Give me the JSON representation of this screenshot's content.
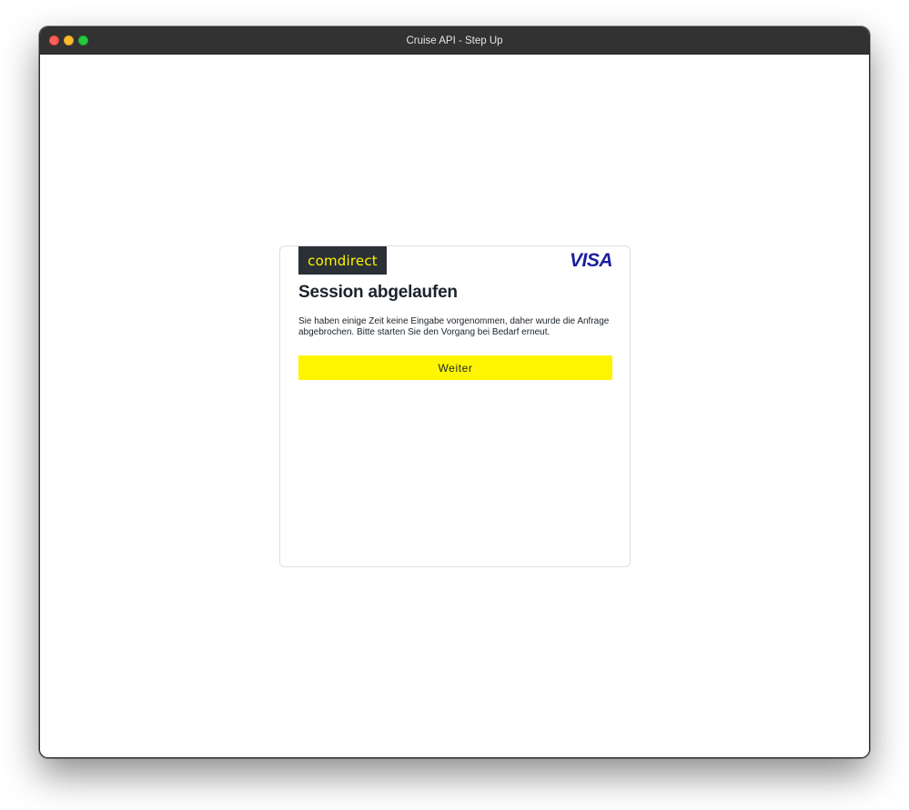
{
  "window": {
    "title": "Cruise API - Step Up"
  },
  "card": {
    "brand_left": "comdirect",
    "brand_right": "VISA",
    "title": "Session abgelaufen",
    "message": "Sie haben einige Zeit keine Eingabe vorgenommen, daher wurde die Anfrage abgebrochen. Bitte starten Sie den Vorgang bei Bedarf erneut.",
    "button_label": "Weiter"
  },
  "colors": {
    "accent_yellow": "#fff500",
    "comdirect_bg": "#2a3036",
    "visa_blue": "#1a1f9e",
    "titlebar": "#323232"
  }
}
